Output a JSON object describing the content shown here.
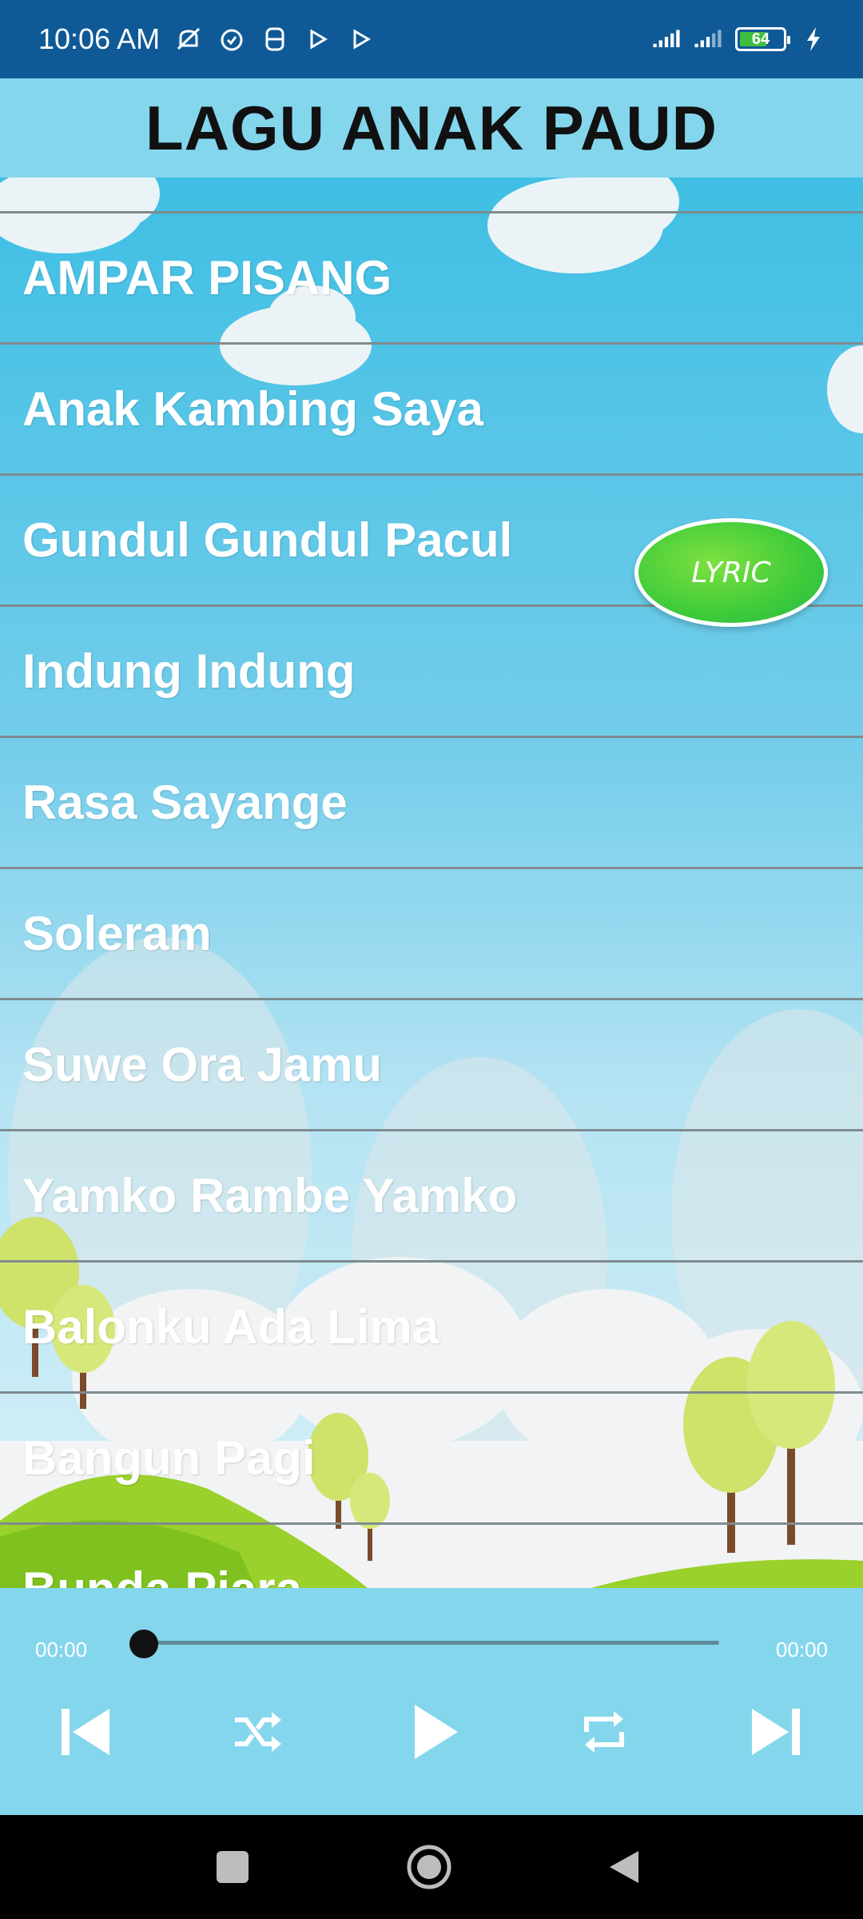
{
  "status_bar": {
    "time": "10:06 AM",
    "battery_level": "64",
    "battery_fraction": 0.64,
    "icons": [
      "mute-icon",
      "alarm-icon",
      "s-app-icon",
      "play-store-icon",
      "play-store-icon",
      "signal-icon",
      "signal-icon",
      "battery-icon",
      "charging-icon"
    ]
  },
  "header": {
    "title": "LAGU ANAK PAUD"
  },
  "songs": [
    {
      "title": "AMPAR PISANG"
    },
    {
      "title": "Anak Kambing Saya"
    },
    {
      "title": "Gundul Gundul Pacul"
    },
    {
      "title": "Indung Indung"
    },
    {
      "title": "Rasa Sayange"
    },
    {
      "title": "Soleram"
    },
    {
      "title": "Suwe Ora Jamu"
    },
    {
      "title": "Yamko Rambe Yamko"
    },
    {
      "title": "Balonku Ada Lima"
    },
    {
      "title": "Bangun Pagi"
    },
    {
      "title": "Bunda Piara"
    }
  ],
  "lyric_button": {
    "label": "LYRIC"
  },
  "player": {
    "current_time": "00:00",
    "total_time": "00:00",
    "progress": 0.0,
    "controls": [
      "previous-icon",
      "shuffle-icon",
      "play-icon",
      "repeat-icon",
      "next-icon"
    ]
  },
  "nav_bar": {
    "buttons": [
      "recents-icon",
      "home-icon",
      "back-icon"
    ]
  },
  "colors": {
    "status_bar": "#0f5a96",
    "header_bg": "#84d6ec",
    "player_bg": "#84d6ec",
    "lyric_green": "#3ecb3a"
  }
}
